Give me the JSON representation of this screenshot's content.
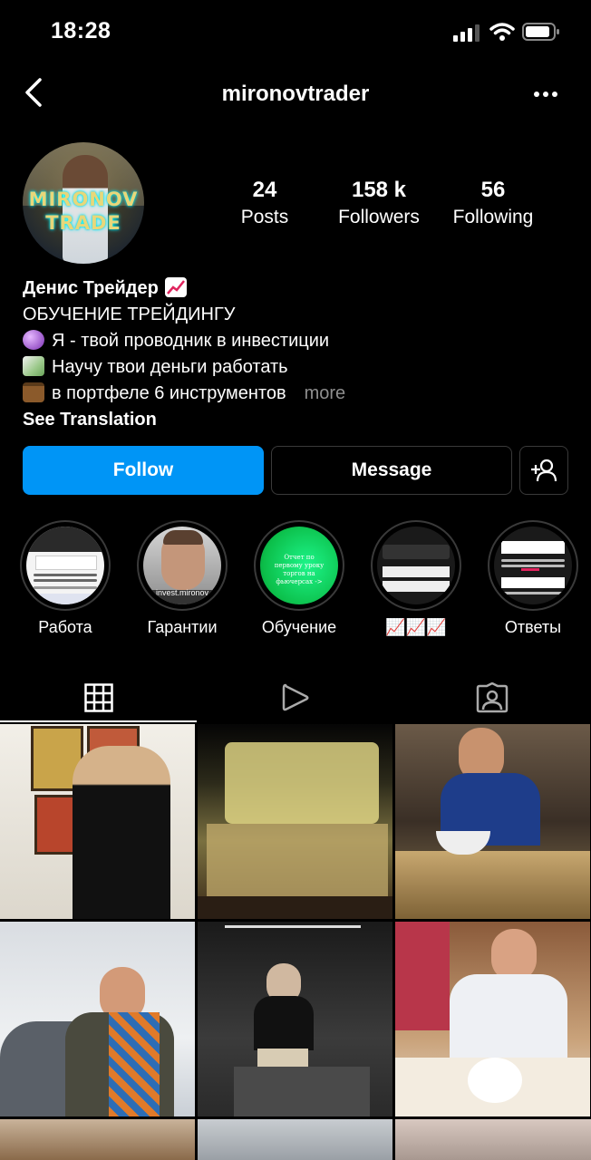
{
  "status_bar": {
    "time": "18:28"
  },
  "header": {
    "username": "mironovtrader"
  },
  "avatar": {
    "logo_line1": "MIRONOV",
    "logo_line2": "TRADE"
  },
  "stats": [
    {
      "value": "24",
      "label": "Posts"
    },
    {
      "value": "158 k",
      "label": "Followers"
    },
    {
      "value": "56",
      "label": "Following"
    }
  ],
  "bio": {
    "name": "Денис Трейдер",
    "line1": "ОБУЧЕНИЕ ТРЕЙДИНГУ",
    "line2": "Я - твой проводник в инвестиции",
    "line3": "Научу твои деньги работать",
    "line4": "в портфеле 6 инструментов",
    "more": "more",
    "see_translation": "See Translation"
  },
  "actions": {
    "follow": "Follow",
    "message": "Message"
  },
  "highlights": [
    {
      "label": "Работа"
    },
    {
      "label": "Гарантии",
      "overlay": "invest.mironov"
    },
    {
      "label": "Обучение",
      "overlay": "Отчет по первому уроку торгов на фьючерсах ->"
    },
    {
      "label": "📈📈📈"
    },
    {
      "label": "Ответы"
    }
  ],
  "tabs": [
    "grid",
    "reels",
    "tagged"
  ],
  "colors": {
    "accent": "#0095f6",
    "background": "#000000",
    "muted": "#8e8e8e",
    "border": "#3a3a3a"
  }
}
